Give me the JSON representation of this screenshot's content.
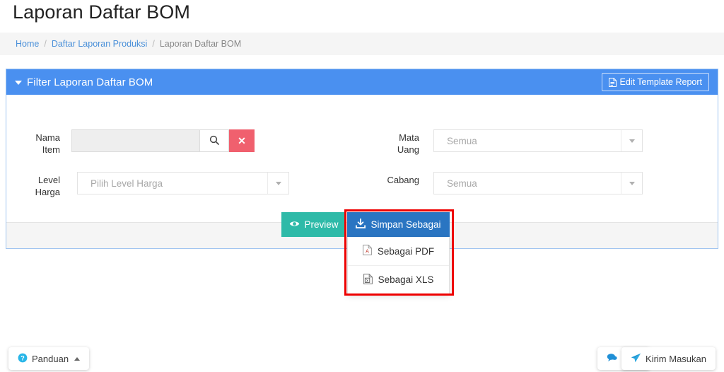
{
  "page": {
    "title": "Laporan Daftar BOM"
  },
  "breadcrumb": {
    "home": "Home",
    "parent": "Daftar Laporan Produksi",
    "current": "Laporan Daftar BOM",
    "separator": "/"
  },
  "panel": {
    "title": "Filter Laporan Daftar BOM",
    "caret_icon": "caret-down-icon",
    "edit_template_button": {
      "label": "Edit Template Report",
      "icon": "document-icon"
    },
    "header_color": "#4a90f0",
    "border_color": "#9fc4f0"
  },
  "form": {
    "nama_item": {
      "label": "Nama Item",
      "label_line1": "Nama",
      "label_line2": "Item",
      "value": "",
      "placeholder": "",
      "search_icon": "search-icon",
      "clear_icon": "close-icon",
      "clear_color": "#f0606e"
    },
    "level_harga": {
      "label": "Level Harga",
      "label_line1": "Level",
      "label_line2": "Harga",
      "value": "Pilih Level Harga",
      "arrow_icon": "chevron-down-icon"
    },
    "mata_uang": {
      "label": "Mata Uang",
      "label_line1": "Mata",
      "label_line2": "Uang",
      "value": "Semua",
      "arrow_icon": "chevron-down-icon"
    },
    "cabang": {
      "label": "Cabang",
      "label_line1": "Cabang",
      "label_line2": "",
      "value": "Semua",
      "arrow_icon": "chevron-down-icon"
    }
  },
  "actions": {
    "preview": {
      "label": "Preview",
      "icon": "eye-icon",
      "color": "#2ebaa8"
    },
    "simpan_sebagai": {
      "label": "Simpan Sebagai",
      "icon": "download-icon",
      "color": "#2a75c2"
    }
  },
  "dropdown": {
    "items": [
      {
        "label": "Sebagai PDF",
        "icon": "pdf-file-icon"
      },
      {
        "label": "Sebagai XLS",
        "icon": "xls-file-icon"
      }
    ]
  },
  "highlight": {
    "color": "#ee0000"
  },
  "footer": {
    "panduan": {
      "label": "Panduan",
      "icon": "question-circle-icon",
      "caret": "caret-up-icon"
    },
    "chat": {
      "label": "Chat",
      "icon": "chat-bubble-icon"
    },
    "kirim_masukan": {
      "label": "Kirim Masukan",
      "icon": "paper-plane-icon"
    }
  }
}
